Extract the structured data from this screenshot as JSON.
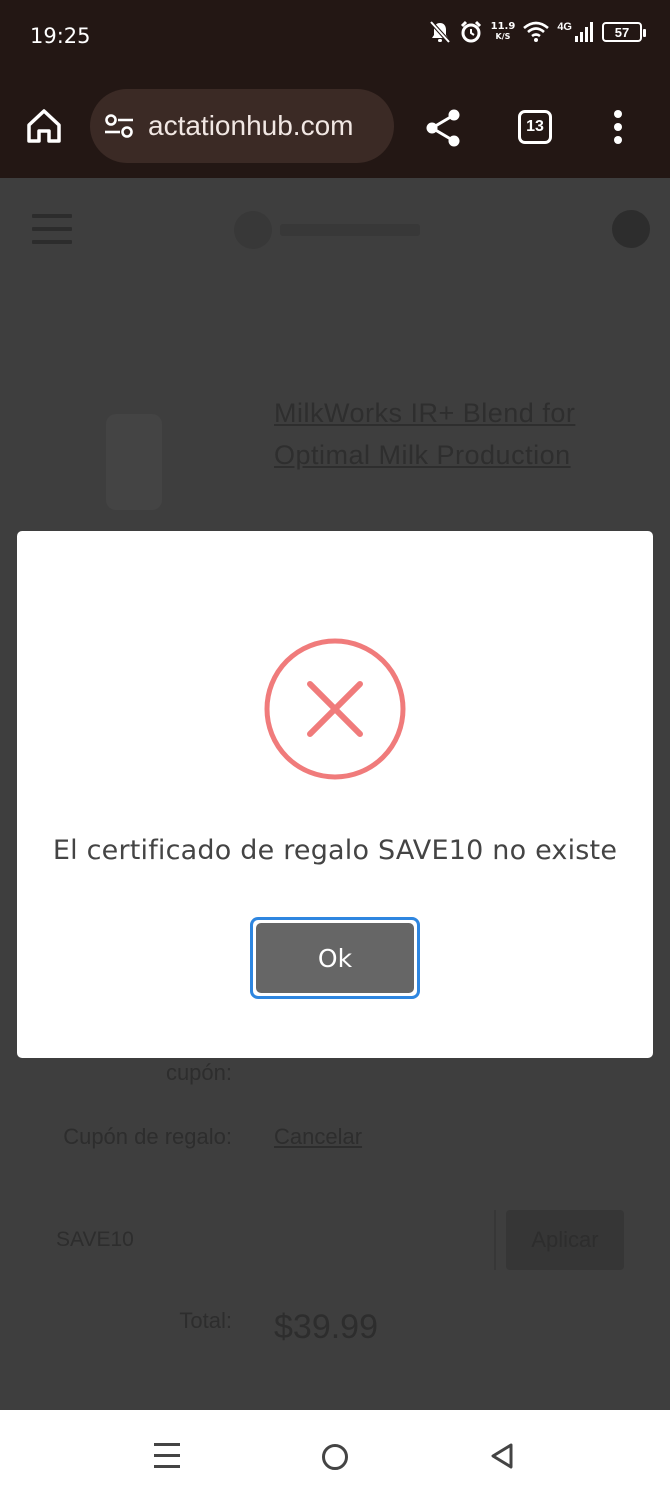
{
  "status_bar": {
    "time": "19:25",
    "net_speed_value": "11.9",
    "net_speed_unit": "K/S",
    "network_type": "4G",
    "battery": "57"
  },
  "browser": {
    "url": "actationhub.com",
    "tab_count": "13"
  },
  "page": {
    "product_title": "MilkWorks IR+ Blend for Optimal Milk Production",
    "coupon_label": "cupón:",
    "gift_coupon_label": "Cupón de regalo:",
    "cancel_link": "Cancelar",
    "coupon_input_value": "SAVE10",
    "apply_button": "Aplicar",
    "total_label": "Total:",
    "total_value": "$39.99"
  },
  "modal": {
    "message": "El certificado de regalo SAVE10 no existe",
    "ok_button": "Ok",
    "icon_color": "#f07b7b",
    "focus_ring_color": "#2e86e0"
  },
  "nav_bar": {
    "buttons": [
      "recents-icon",
      "home-icon",
      "back-icon"
    ]
  }
}
